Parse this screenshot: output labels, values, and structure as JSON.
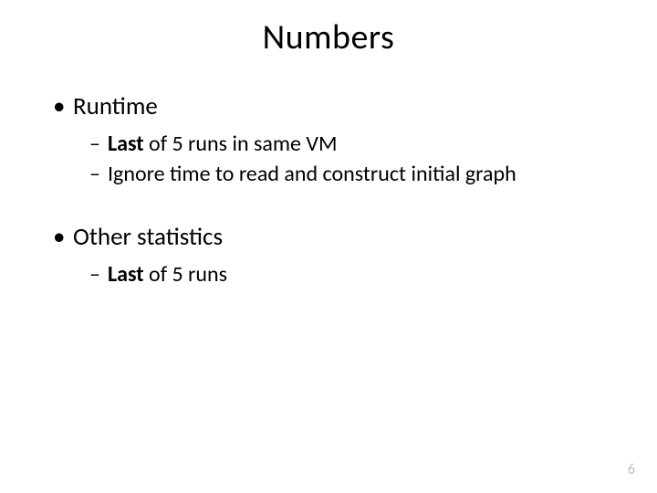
{
  "title": "Numbers",
  "sections": [
    {
      "heading": "Runtime",
      "items": [
        {
          "bold_prefix": "Last",
          "rest": " of 5 runs in same VM"
        },
        {
          "bold_prefix": "",
          "rest": "Ignore time to read and construct initial graph"
        }
      ]
    },
    {
      "heading": "Other statistics",
      "items": [
        {
          "bold_prefix": "Last",
          "rest": " of 5 runs"
        }
      ]
    }
  ],
  "page_number": "6"
}
